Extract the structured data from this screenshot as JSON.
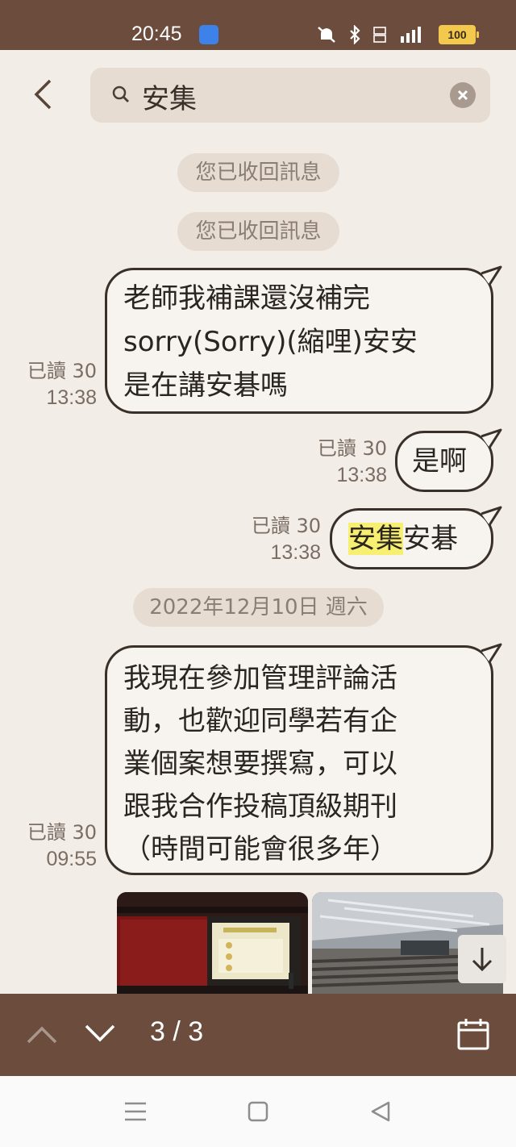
{
  "status_bar": {
    "time": "20:45",
    "battery": "100",
    "network": "4G"
  },
  "search": {
    "query": "安集"
  },
  "messages": [
    {
      "type": "system",
      "text": "您已收回訊息"
    },
    {
      "type": "system",
      "text": "您已收回訊息"
    },
    {
      "type": "outgoing",
      "lines": [
        "老師我補課還沒補完",
        "sorry(Sorry)(縮哩)安安",
        "是在講安碁嗎"
      ],
      "read": "已讀 30",
      "time": "13:38"
    },
    {
      "type": "outgoing",
      "lines": [
        "是啊"
      ],
      "read": "已讀 30",
      "time": "13:38"
    },
    {
      "type": "outgoing",
      "highlight": "安集",
      "rest": "安碁",
      "read": "已讀 30",
      "time": "13:38"
    },
    {
      "type": "date",
      "text": "2022年12月10日 週六"
    },
    {
      "type": "outgoing",
      "lines": [
        "我現在參加管理評論活",
        "動，也歡迎同學若有企",
        "業個案想要撰寫，可以",
        "跟我合作投稿頂級期刊",
        "（時間可能會很多年）"
      ],
      "read": "已讀 30",
      "time": "09:55"
    }
  ],
  "toolbar": {
    "counter": "3 / 3"
  },
  "icons": {
    "back": "chevron-left-icon",
    "search": "search-icon",
    "clear": "close-icon",
    "prev": "chevron-up-icon",
    "next": "chevron-down-icon",
    "calendar": "calendar-icon",
    "scroll_down": "arrow-down-icon"
  },
  "colors": {
    "bar_brown": "#6b4c3d",
    "background": "#f2ede6",
    "highlight": "#f6ef72",
    "pill": "#e6dcd2"
  }
}
